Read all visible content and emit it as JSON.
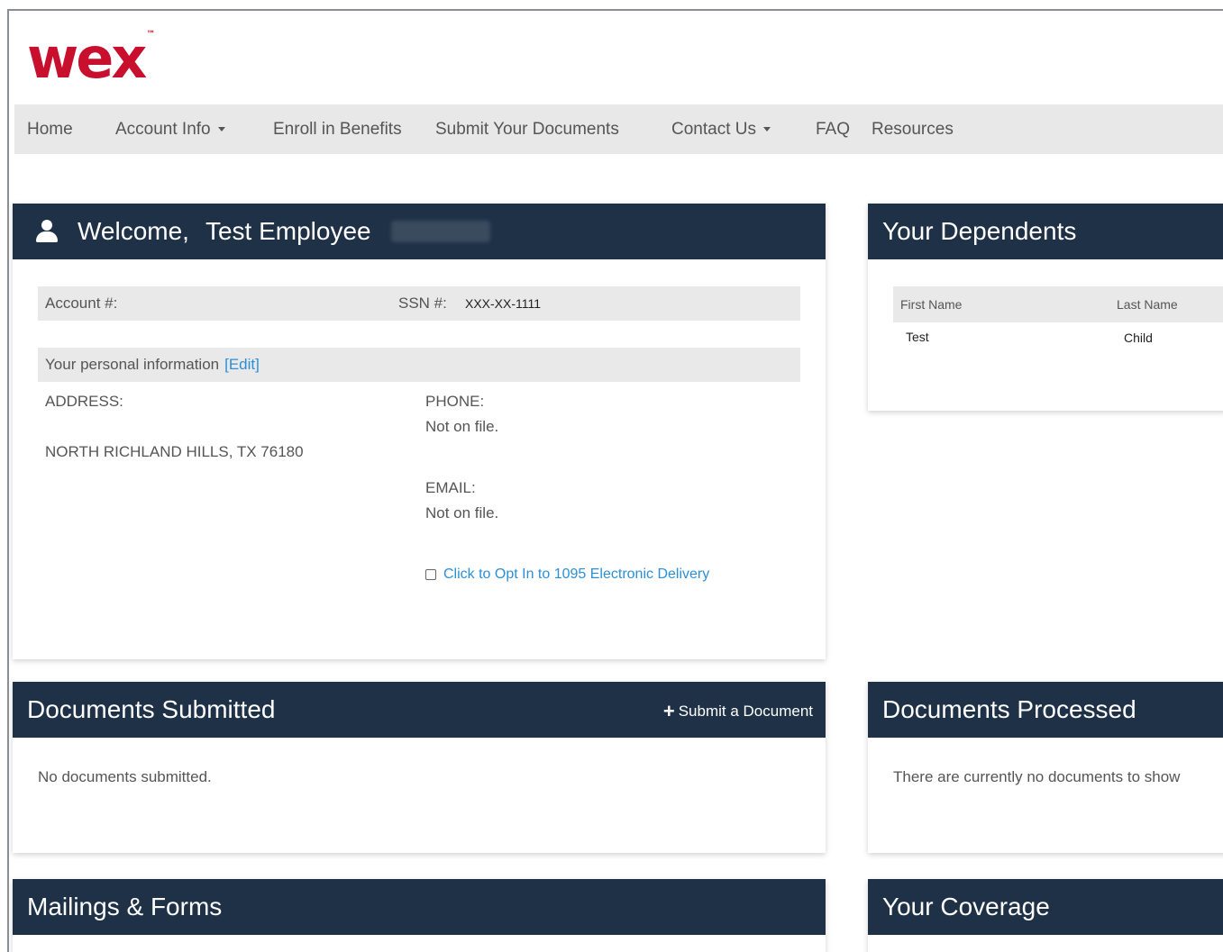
{
  "brand": {
    "logo_text": "wex",
    "logo_color": "#c8102e"
  },
  "nav": {
    "items": [
      {
        "label": "Home"
      },
      {
        "label": "Account Info"
      },
      {
        "label": "Enroll in Benefits"
      },
      {
        "label": "Submit Your Documents"
      },
      {
        "label": "Contact Us"
      },
      {
        "label": "FAQ"
      },
      {
        "label": "Resources"
      }
    ]
  },
  "welcome": {
    "greeting": "Welcome,",
    "name": "Test Employee",
    "account_label": "Account #:",
    "ssn_label": "SSN #:",
    "ssn_value": "XXX-XX-1111",
    "personal_info_label": "Your personal information",
    "edit_label": "[Edit]",
    "address_label": "ADDRESS:",
    "address_value": "NORTH RICHLAND HILLS, TX 76180",
    "phone_label": "PHONE:",
    "phone_value": "Not on file.",
    "email_label": "EMAIL:",
    "email_value": "Not on file.",
    "opt_in_label": "Click to Opt In to 1095 Electronic Delivery"
  },
  "dependents": {
    "title": "Your Dependents",
    "columns": [
      "First Name",
      "Last Name"
    ],
    "rows": [
      [
        "Test",
        "Child"
      ]
    ]
  },
  "documents_submitted": {
    "title": "Documents Submitted",
    "action_label": "Submit a Document",
    "empty_text": "No documents submitted."
  },
  "documents_processed": {
    "title": "Documents Processed",
    "empty_text": "There are currently no documents to show"
  },
  "mailings": {
    "title": "Mailings & Forms"
  },
  "coverage": {
    "title": "Your Coverage"
  },
  "colors": {
    "header_bg": "#1e3147",
    "link": "#2c8fd6",
    "navbar_bg": "#e8e8e8"
  }
}
